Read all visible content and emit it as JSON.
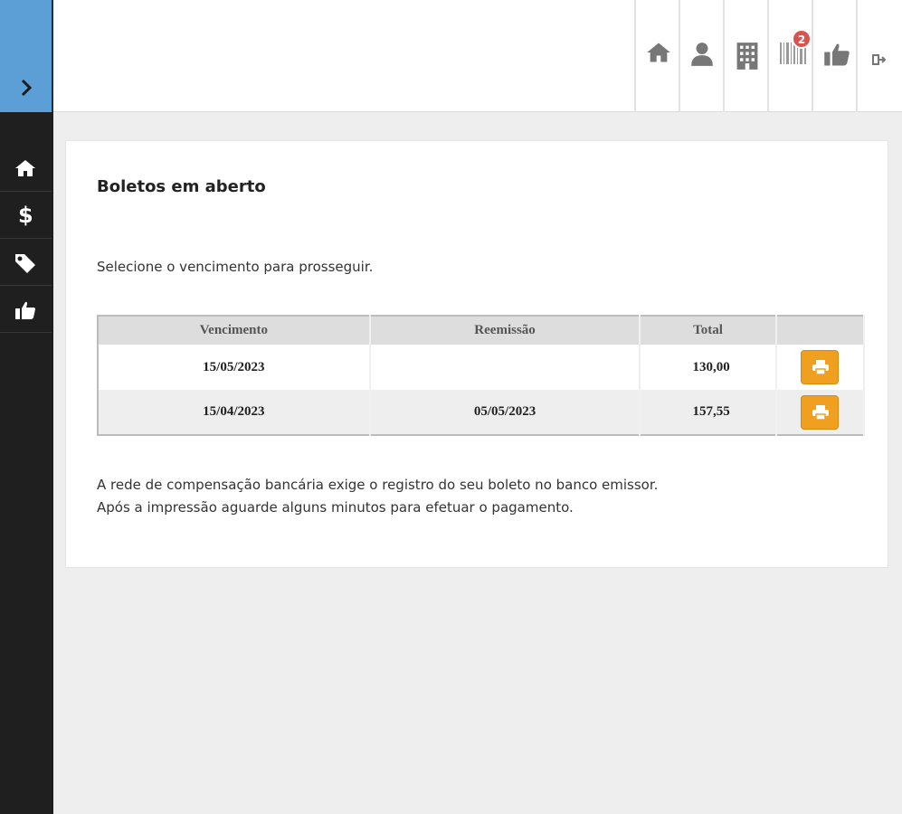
{
  "sidebar": {
    "items": [
      {
        "name": "home",
        "icon": "home-icon"
      },
      {
        "name": "financeiro",
        "icon": "dollar-icon"
      },
      {
        "name": "tags",
        "icon": "tag-icon"
      },
      {
        "name": "avaliacao",
        "icon": "thumbs-up-icon"
      }
    ],
    "toggle_icon": "chevron-right-icon"
  },
  "header": {
    "buttons": [
      {
        "icon": "home-icon"
      },
      {
        "icon": "user-icon"
      },
      {
        "icon": "building-icon"
      },
      {
        "icon": "barcode-icon",
        "badge": "2"
      },
      {
        "icon": "thumbs-up-icon"
      },
      {
        "icon": "sign-out-icon"
      }
    ]
  },
  "main": {
    "title": "Boletos em aberto",
    "subtitle": "Selecione o vencimento para prosseguir.",
    "table": {
      "headers": [
        "Vencimento",
        "Reemissão",
        "Total",
        ""
      ],
      "rows": [
        {
          "vencimento": "15/05/2023",
          "reemissao": "",
          "total": "130,00"
        },
        {
          "vencimento": "15/04/2023",
          "reemissao": "05/05/2023",
          "total": "157,55"
        }
      ]
    },
    "note_line1": "A rede de compensação bancária exige o registro do seu boleto no banco emissor.",
    "note_line2": "Após a impressão aguarde alguns minutos para efetuar o pagamento."
  },
  "colors": {
    "sidebar_bg": "#1f1f1f",
    "toggle_bg": "#5b9fd6",
    "print_button": "#f0a020",
    "badge": "#d9534f"
  }
}
